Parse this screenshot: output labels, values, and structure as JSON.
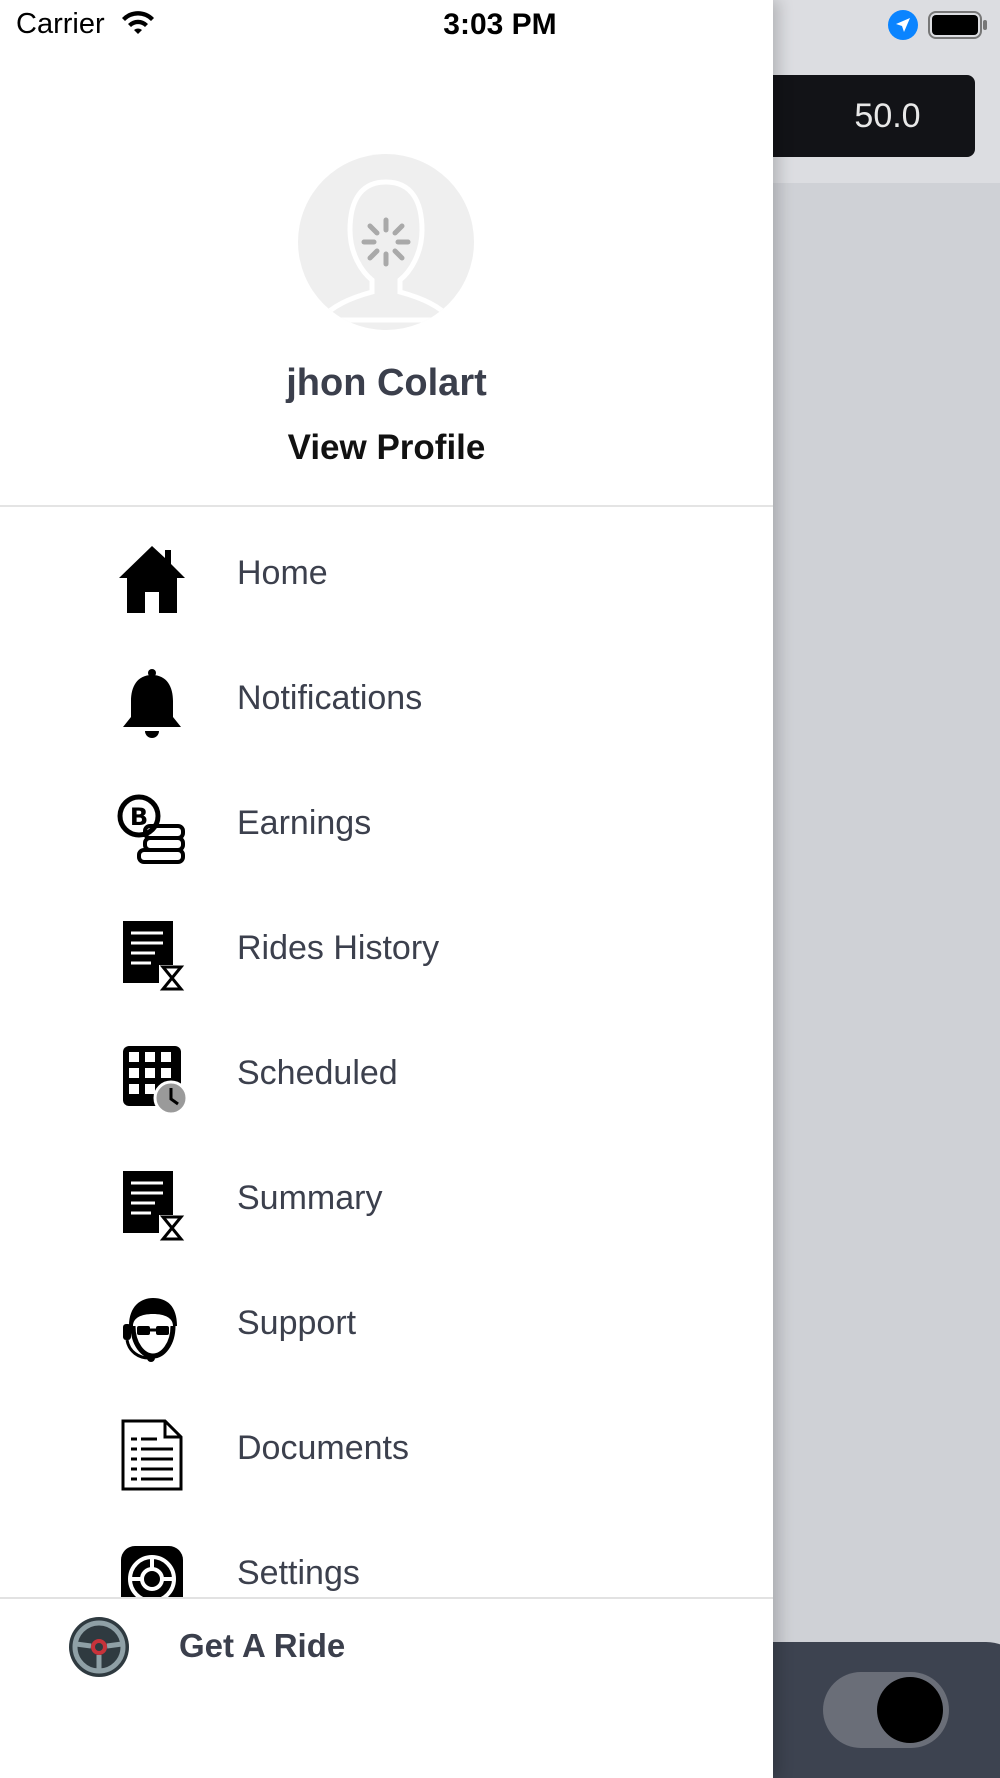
{
  "status_bar": {
    "carrier": "Carrier",
    "time": "3:03 PM"
  },
  "background": {
    "value": "50.0"
  },
  "profile": {
    "name": "jhon Colart",
    "view_profile_label": "View Profile"
  },
  "menu": [
    {
      "label": "Home",
      "icon": "home-icon"
    },
    {
      "label": "Notifications",
      "icon": "bell-icon"
    },
    {
      "label": "Earnings",
      "icon": "coins-icon"
    },
    {
      "label": "Rides History",
      "icon": "history-document-icon"
    },
    {
      "label": "Scheduled",
      "icon": "calendar-clock-icon"
    },
    {
      "label": "Summary",
      "icon": "summary-document-icon"
    },
    {
      "label": "Support",
      "icon": "support-agent-icon"
    },
    {
      "label": "Documents",
      "icon": "documents-icon"
    },
    {
      "label": "Settings",
      "icon": "settings-icon"
    }
  ],
  "footer": {
    "get_ride_label": "Get A Ride",
    "icon": "steering-wheel-icon"
  },
  "colors": {
    "text": "#3c404d",
    "accent_blue": "#0a84ff",
    "dark_panel": "#3d4350"
  }
}
